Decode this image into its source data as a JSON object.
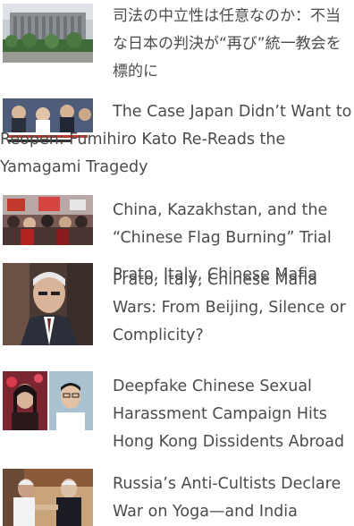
{
  "articles": [
    {
      "title": "司法の中立性は任意なのか：不当な日本の判決が“再び”統一教会を標的に",
      "image": "courthouse-building"
    },
    {
      "title": "The Case Japan Didn’t Want to Reopen: Fumihiro Kato Re-Reads the Yamagami Tragedy",
      "image": "news-broadcast-crowd"
    },
    {
      "title": "China, Kazakhstan, and the “Chinese Flag Burning” Trial",
      "image": "protest-crowd-flags"
    },
    {
      "title": "Prato, Italy, Chinese Mafia Wars: From Beijing, Silence or Complicity?",
      "title_ghost": "Prato, Italy, Chinese Mafia",
      "image": "man-portrait-suit"
    },
    {
      "title": "Deepfake Chinese Sexual Harassment Campaign Hits Hong Kong Dissidents Abroad",
      "image": "two-portraits"
    },
    {
      "title": "Russia’s Anti-Cultists Declare War on Yoga—and India",
      "image": "handshake-meeting"
    }
  ],
  "colors": {
    "text": "#4b4b4b",
    "background": "#ffffff"
  }
}
